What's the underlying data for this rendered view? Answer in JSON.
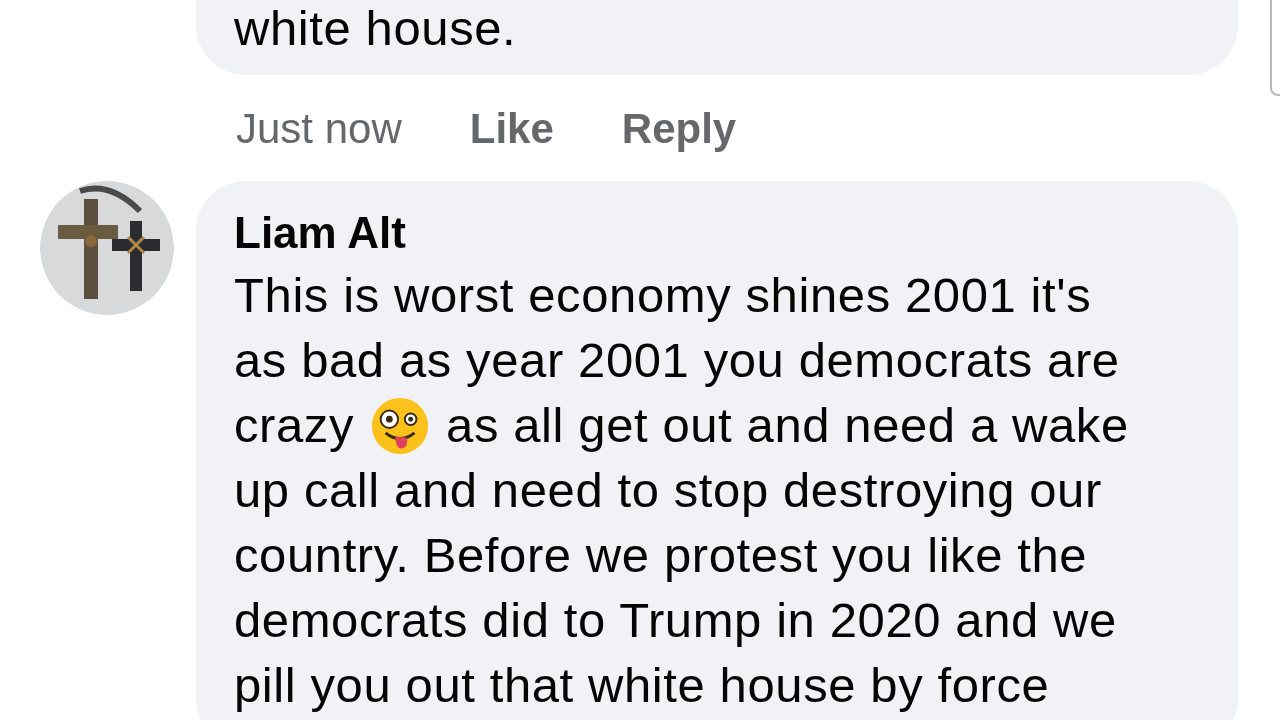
{
  "comments": [
    {
      "kind": "partial",
      "lines": [
        {
          "text": "white house."
        }
      ],
      "time": "Just now",
      "actions": [
        "Like",
        "Reply"
      ]
    },
    {
      "kind": "full",
      "author": "Liam Alt",
      "lines": [
        {
          "text": "This is worst economy shines 2001 it's"
        },
        {
          "text": "as bad as year 2001 you democrats are"
        },
        {
          "text": "crazy",
          "after_emoji": "as all get out and need a wake"
        },
        {
          "text": "up call and need to stop destroying our"
        },
        {
          "text": "country. Before we protest you like the"
        },
        {
          "text": "democrats did to Trump in 2020 and we"
        },
        {
          "text": "pill you out that white house by force"
        }
      ]
    }
  ]
}
